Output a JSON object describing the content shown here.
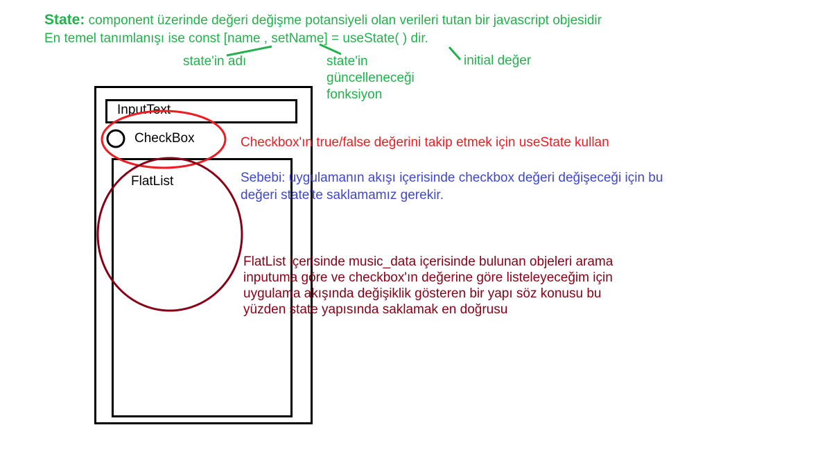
{
  "header": {
    "state_label": "State:",
    "line1_rest": " component üzerinde değeri değişme potansiyeli olan verileri tutan bir javascript objesidir",
    "line2": "En temel tanımlanışı ise const [name , setName] = useState( ) dir."
  },
  "annotations": {
    "state_name": "state'in adı",
    "setter_line1": "state'in",
    "setter_line2": "güncelleneceği",
    "setter_line3": "fonksiyon",
    "initial_value": "initial değer"
  },
  "mockup": {
    "input_label": "InputText",
    "checkbox_label": "CheckBox",
    "flatlist_label": "FlatList"
  },
  "notes": {
    "checkbox_note": "Checkbox'ın true/false değerini takip etmek için useState kullan",
    "reason_line1": "Sebebi: uygulamanın akışı içerisinde checkbox değeri değişeceği için bu",
    "reason_line2": "değeri state'te saklamamız gerekir.",
    "flatlist_line1": "FlatList içerisinde music_data içerisinde bulunan objeleri arama",
    "flatlist_line2": "inputuma göre ve checkbox'ın değerine göre listeleyeceğim için",
    "flatlist_line3": "uygulama akışında değişiklik gösteren bir yapı söz konusu bu",
    "flatlist_line4": "yüzden state yapısında saklamak en doğrusu"
  },
  "colors": {
    "green": "#22b14c",
    "red": "#ed1c24",
    "blue": "#3f48cc",
    "maroon": "#880015",
    "black": "#000000"
  }
}
